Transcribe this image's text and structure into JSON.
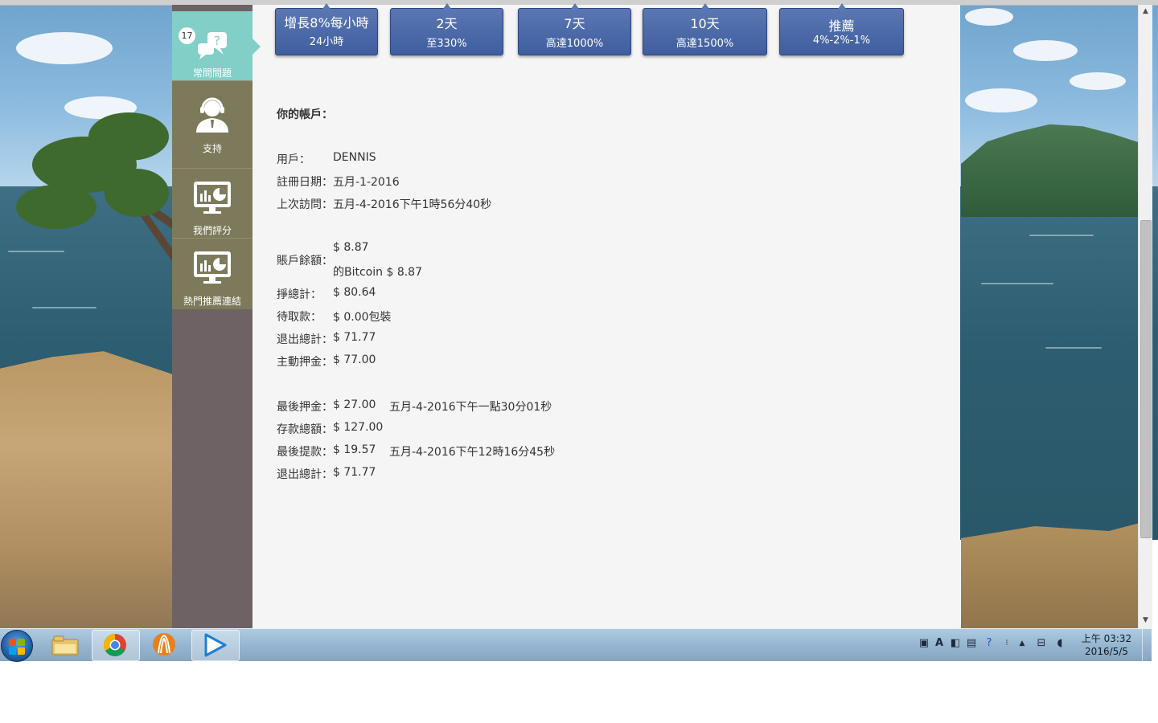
{
  "sidebar": {
    "badge_count": "17",
    "items": [
      {
        "label": "常問問題",
        "icon": "faq-chat-icon"
      },
      {
        "label": "支持",
        "icon": "support-headset-icon"
      },
      {
        "label": "我們評分",
        "icon": "monitor-chart-icon"
      },
      {
        "label": "熱門推薦連結",
        "icon": "monitor-chart-icon"
      }
    ]
  },
  "plans": [
    {
      "line1": "增長8%每小時",
      "line2": "24小時"
    },
    {
      "line1": "2天",
      "line2": "至330%"
    },
    {
      "line1": "7天",
      "line2": "高達1000%"
    },
    {
      "line1": "10天",
      "line2": "高達1500%"
    },
    {
      "line1": "推薦",
      "line2": "4%-2%-1%"
    }
  ],
  "account": {
    "title": "你的帳戶：",
    "user_label": "用戶：",
    "user_value": "DENNIS",
    "reg_label": "註冊日期：",
    "reg_value": "五月-1-2016",
    "last_visit_label": "上次訪問：",
    "last_visit_value": "五月-4-2016下午1時56分40秒",
    "balance_label": "賬戶餘額：",
    "balance_value": "$ 8.87",
    "balance_btc": "的Bitcoin $ 8.87",
    "earned_label": "掙總計：",
    "earned_value": "$ 80.64",
    "pending_label": "待取款：",
    "pending_value": "$ 0.00包裝",
    "withdrawn_label": "退出總計：",
    "withdrawn_value": "$ 71.77",
    "active_label": "主動押金：",
    "active_value": "$ 77.00",
    "last_deposit_label": "最後押金：",
    "last_deposit_value": "$ 27.00",
    "last_deposit_date": "五月-4-2016下午一點30分01秒",
    "total_deposit_label": "存款總額：",
    "total_deposit_value": "$ 127.00",
    "last_withdraw_label": "最後提款：",
    "last_withdraw_value": "$ 19.57",
    "last_withdraw_date": "五月-4-2016下午12時16分45秒",
    "withdrawn2_label": "退出總計：",
    "withdrawn2_value": "$ 71.77"
  },
  "taskbar": {
    "clock_time": "上午 03:32",
    "clock_date": "2016/5/5",
    "apps": [
      "file-explorer-icon",
      "chrome-icon",
      "orange-app-icon",
      "media-player-icon"
    ]
  }
}
